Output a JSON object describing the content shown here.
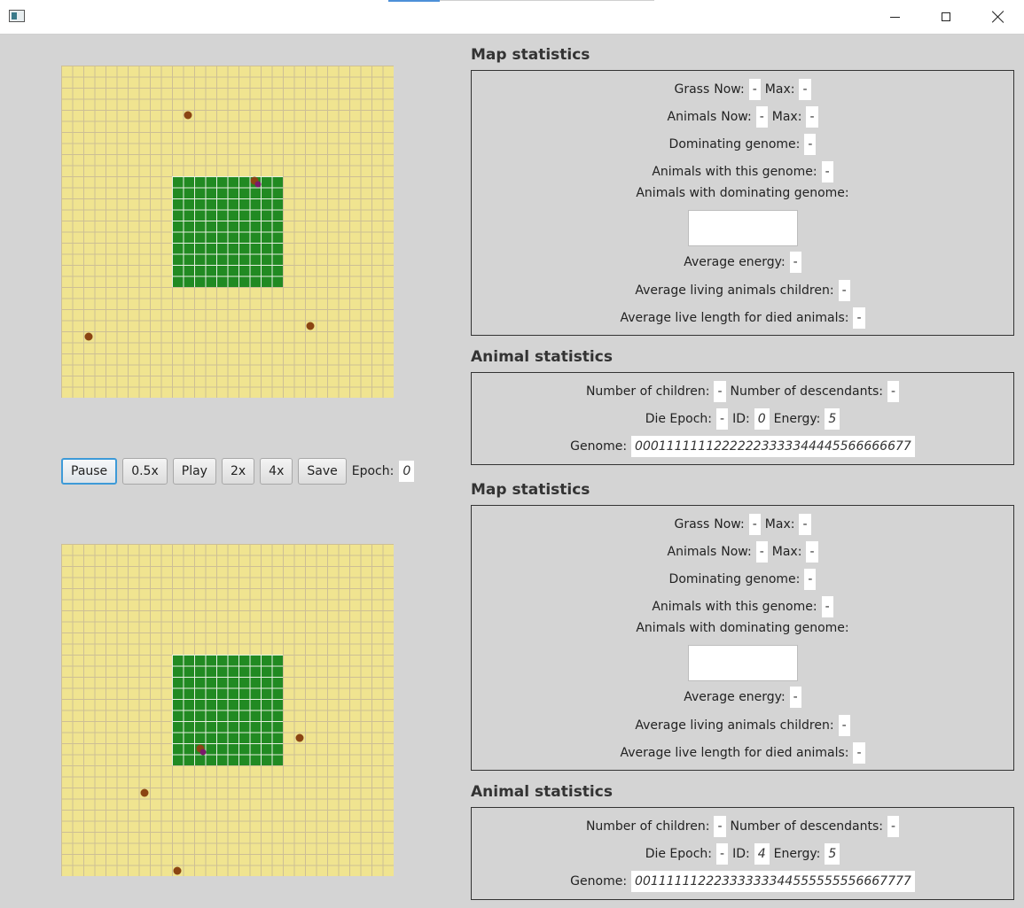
{
  "window": {
    "title": ""
  },
  "colors": {
    "background": "#d4d4d4",
    "steppe": "#f0e490",
    "jungle": "#218a22",
    "animal": "#8b4513",
    "dominant_animal": "#7a1a6a",
    "focus": "#3d9ad8"
  },
  "icons": [
    "app-icon",
    "minimize-icon",
    "maximize-icon",
    "close-icon"
  ],
  "controls": {
    "pause": "Pause",
    "speed_half": "0.5x",
    "play": "Play",
    "speed_2x": "2x",
    "speed_4x": "4x",
    "save": "Save",
    "epoch_label": "Epoch:",
    "epoch_value": "0"
  },
  "panels": [
    {
      "map_title": "Map statistics",
      "grass_label": "Grass",
      "now_label": "Now:",
      "max_label": "Max:",
      "grass_now": "-",
      "grass_max": "-",
      "animals_label": "Animals",
      "animals_now": "-",
      "animals_max": "-",
      "dominating_genome_label": "Dominating genome:",
      "dominating_genome": "-",
      "animals_with_genome_label": "Animals with this genome:",
      "animals_with_genome": "-",
      "animals_with_dominating_label": "Animals with dominating genome:",
      "average_energy_label": "Average energy:",
      "average_energy": "-",
      "avg_children_label": "Average living animals children:",
      "avg_children": "-",
      "avg_lifespan_label": "Average live length for died animals:",
      "avg_lifespan": "-",
      "animal_title": "Animal statistics",
      "children_label": "Number of children:",
      "children": "-",
      "descendants_label": "Number of descendants:",
      "descendants": "-",
      "die_epoch_label": "Die Epoch:",
      "die_epoch": "-",
      "id_label": "ID:",
      "id": "0",
      "energy_label": "Energy:",
      "energy": "5",
      "genome_label": "Genome:",
      "genome": "00011111112222223333344445566666677"
    },
    {
      "map_title": "Map statistics",
      "grass_label": "Grass",
      "now_label": "Now:",
      "max_label": "Max:",
      "grass_now": "-",
      "grass_max": "-",
      "animals_label": "Animals",
      "animals_now": "-",
      "animals_max": "-",
      "dominating_genome_label": "Dominating genome:",
      "dominating_genome": "-",
      "animals_with_genome_label": "Animals with this genome:",
      "animals_with_genome": "-",
      "animals_with_dominating_label": "Animals with dominating genome:",
      "average_energy_label": "Average energy:",
      "average_energy": "-",
      "avg_children_label": "Average living animals children:",
      "avg_children": "-",
      "avg_lifespan_label": "Average live length for died animals:",
      "avg_lifespan": "-",
      "animal_title": "Animal statistics",
      "children_label": "Number of children:",
      "children": "-",
      "descendants_label": "Number of descendants:",
      "descendants": "-",
      "die_epoch_label": "Die Epoch:",
      "die_epoch": "-",
      "id_label": "ID:",
      "id": "4",
      "energy_label": "Energy:",
      "energy": "5",
      "genome_label": "Genome:",
      "genome": "00111111222333333344555555556667777"
    }
  ]
}
